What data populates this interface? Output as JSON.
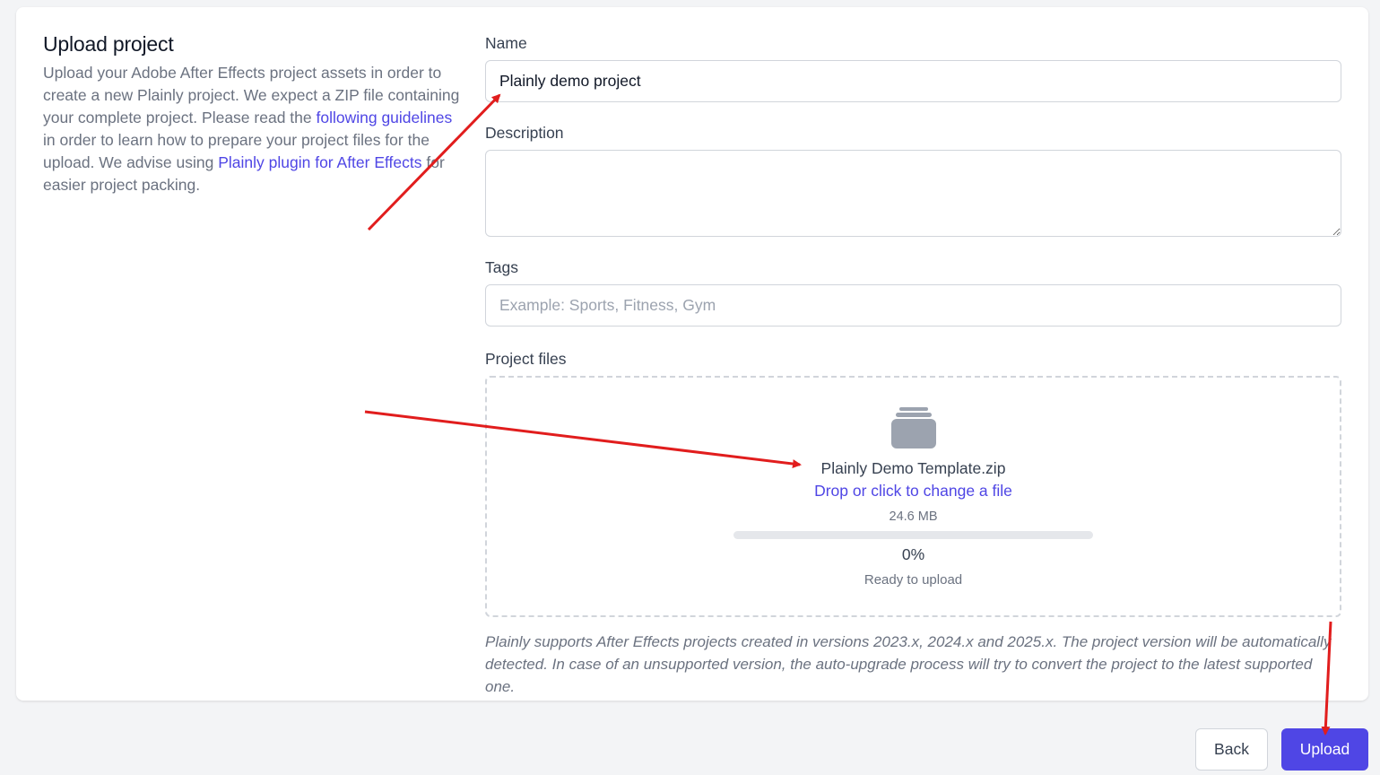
{
  "intro": {
    "title": "Upload project",
    "text_1": "Upload your Adobe After Effects project assets in order to create a new Plainly project. We expect a ZIP file containing your complete project. Please read the ",
    "link_guidelines": "following guidelines",
    "text_2": " in order to learn how to prepare your project files for the upload. We advise using ",
    "link_plugin": "Plainly plugin for After Effects",
    "text_3": " for easier project packing."
  },
  "form": {
    "name_label": "Name",
    "name_value": "Plainly demo project",
    "description_label": "Description",
    "description_value": "",
    "tags_label": "Tags",
    "tags_placeholder": "Example: Sports, Fitness, Gym",
    "files_label": "Project files"
  },
  "dropzone": {
    "icon": "zip-archive-icon",
    "file_name": "Plainly Demo Template.zip",
    "change_text": "Drop or click to change a file",
    "file_size": "24.6 MB",
    "progress": 0,
    "progress_text": "0%",
    "status": "Ready to upload"
  },
  "note": "Plainly supports After Effects projects created in versions 2023.x, 2024.x and 2025.x. The project version will be automatically detected. In case of an unsupported version, the auto-upgrade process will try to convert the project to the latest supported one.",
  "buttons": {
    "back": "Back",
    "upload": "Upload"
  },
  "colors": {
    "accent": "#4f46e5",
    "annotation_arrow": "#e11d1d"
  }
}
